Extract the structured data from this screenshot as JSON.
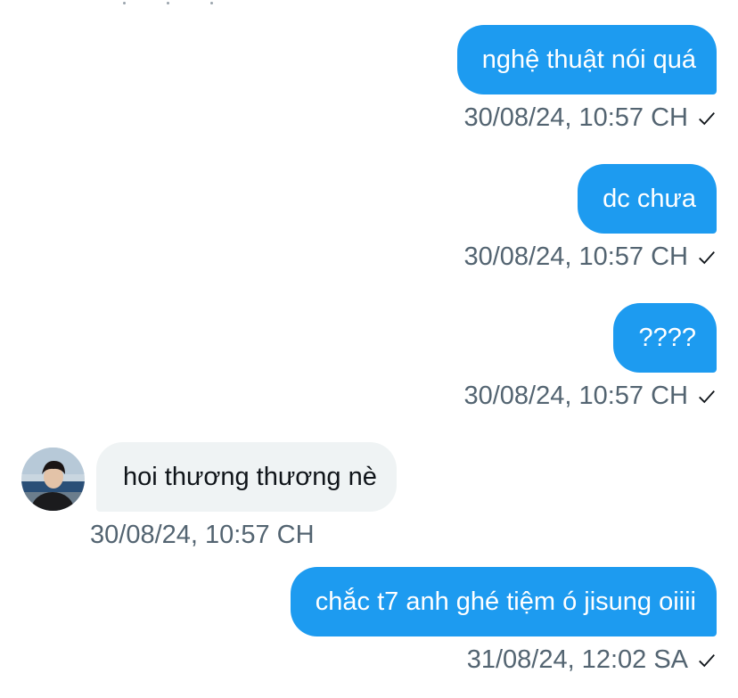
{
  "conversation": {
    "messages": [
      {
        "direction": "outgoing",
        "text": "nghệ thuật nói quá",
        "timestamp": "30/08/24, 10:57 CH",
        "status": "sent-check-icon"
      },
      {
        "direction": "outgoing",
        "text": "dc chưa",
        "timestamp": "30/08/24, 10:57 CH",
        "status": "sent-check-icon"
      },
      {
        "direction": "outgoing",
        "text": "????",
        "timestamp": "30/08/24, 10:57 CH",
        "status": "sent-check-icon"
      },
      {
        "direction": "incoming",
        "text": "hoi thương thương nè",
        "timestamp": "30/08/24, 10:57 CH"
      },
      {
        "direction": "outgoing",
        "text": "chắc t7 anh ghé tiệm ó jisung oiiii",
        "timestamp": "31/08/24, 12:02 SA",
        "status": "sent-check-icon"
      }
    ]
  },
  "colors": {
    "outgoing_bubble": "#1d9bf0",
    "incoming_bubble": "#eff3f4",
    "timestamp_text": "#536471"
  }
}
